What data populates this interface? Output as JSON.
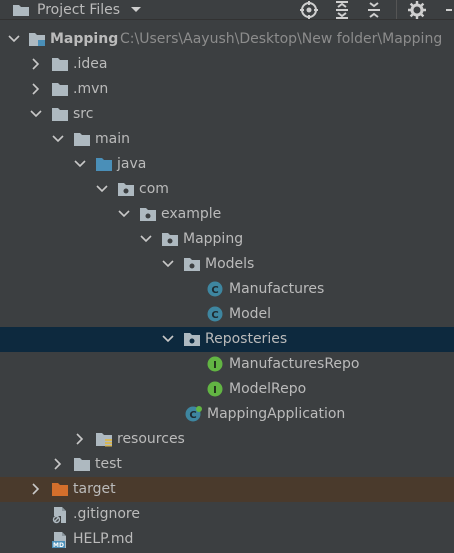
{
  "toolbar": {
    "view_label": "Project Files",
    "icons": [
      "folder-icon",
      "chevron-down-icon",
      "locate-icon",
      "expand-all-icon",
      "collapse-all-icon",
      "gear-icon"
    ]
  },
  "tree": {
    "root": {
      "label": "Mapping",
      "path": "C:\\Users\\Aayush\\Desktop\\New folder\\Mapping"
    },
    "items": [
      {
        "label": ".idea"
      },
      {
        "label": ".mvn"
      },
      {
        "label": "src"
      },
      {
        "label": "main"
      },
      {
        "label": "java"
      },
      {
        "label": "com"
      },
      {
        "label": "example"
      },
      {
        "label": "Mapping"
      },
      {
        "label": "Models"
      },
      {
        "label": "Manufactures"
      },
      {
        "label": "Model"
      },
      {
        "label": "Reposteries"
      },
      {
        "label": "ManufacturesRepo"
      },
      {
        "label": "ModelRepo"
      },
      {
        "label": "MappingApplication"
      },
      {
        "label": "resources"
      },
      {
        "label": "test"
      },
      {
        "label": "target"
      },
      {
        "label": ".gitignore"
      },
      {
        "label": "HELP.md"
      }
    ]
  },
  "colors": {
    "background": "#3c3f41",
    "selection": "#0d293e",
    "class_icon": "#3e86a0",
    "interface_icon": "#62b543",
    "excluded_folder": "#d46f2c",
    "source_folder": "#4a8fb8"
  }
}
